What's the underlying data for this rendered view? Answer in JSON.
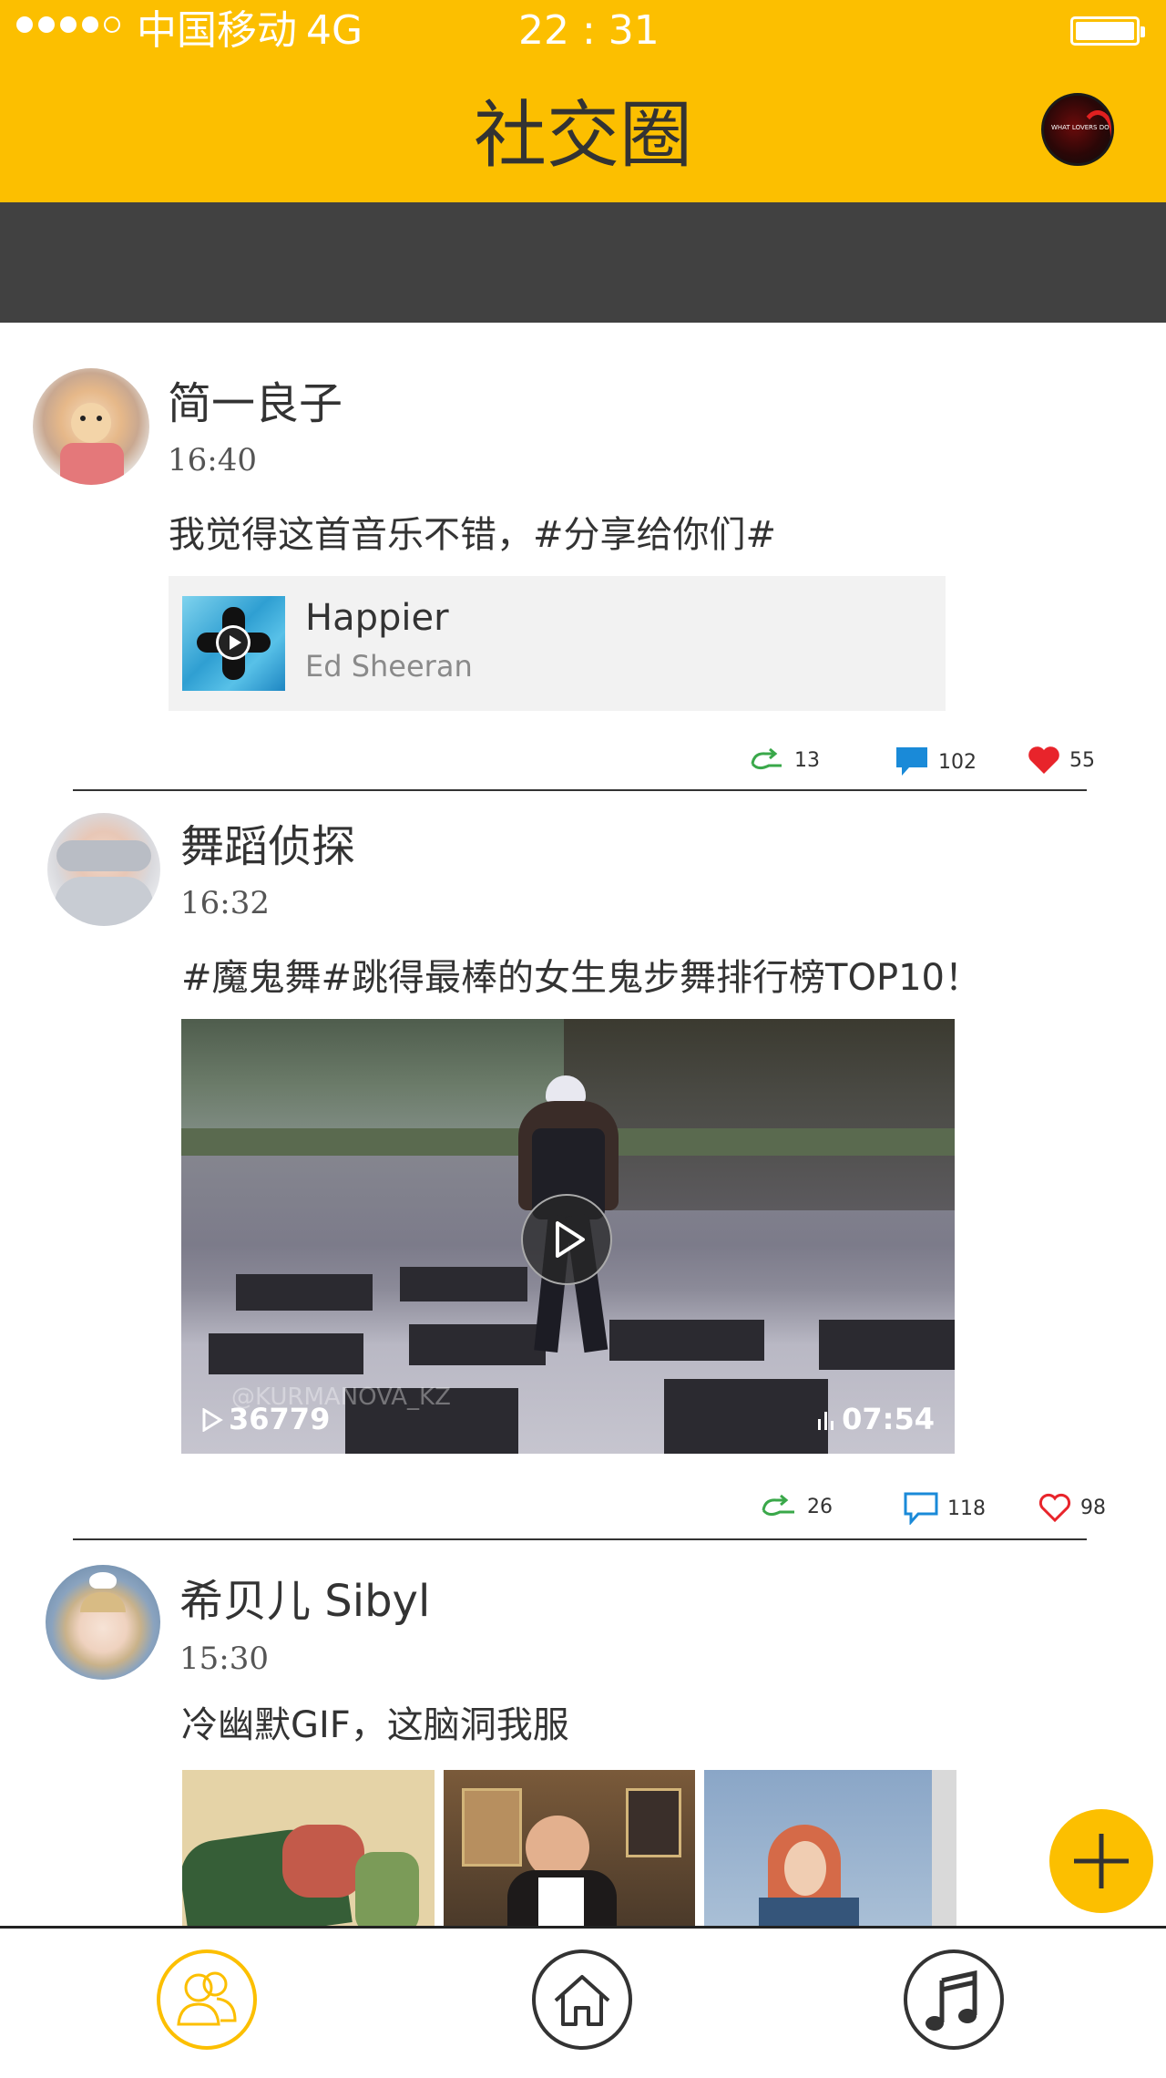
{
  "status_bar": {
    "carrier": "中国移动",
    "network": "4G",
    "time": "22 : 31"
  },
  "header": {
    "title": "社交圈",
    "avatar_text": "WHAT LOVERS DO"
  },
  "posts": [
    {
      "username": "简一良子",
      "time": "16:40",
      "text": "我觉得这首音乐不错，#分享给你们#",
      "music": {
        "title": "Happier",
        "artist": "Ed Sheeran"
      },
      "stats": {
        "shares": "13",
        "comments": "102",
        "likes": "55"
      }
    },
    {
      "username": "舞蹈侦探",
      "time": "16:32",
      "text": "#魔鬼舞#跳得最棒的女生鬼步舞排行榜TOP10！",
      "video": {
        "views": "36779",
        "duration": "07:54",
        "watermark": "@KURMANOVA_KZ"
      },
      "stats": {
        "shares": "26",
        "comments": "118",
        "likes": "98"
      }
    },
    {
      "username": "希贝儿 Sibyl",
      "time": "15:30",
      "text": "冷幽默GIF，这脑洞我服"
    }
  ],
  "bottom_nav": {
    "items": [
      "social-circle",
      "home",
      "music"
    ],
    "active": "social-circle"
  },
  "colors": {
    "accent": "#fcbf00",
    "banner": "#414141",
    "share_green": "#3aa84a",
    "comment_blue": "#1a8ad8",
    "like_red": "#e8242b"
  }
}
